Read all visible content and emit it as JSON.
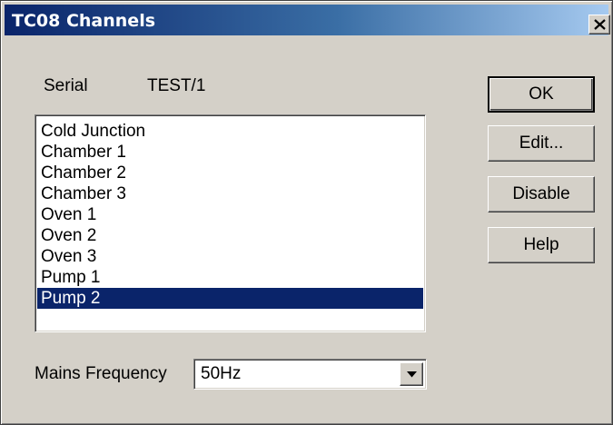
{
  "window": {
    "title": "TC08 Channels",
    "close_icon": "close-x-icon"
  },
  "serial": {
    "label": "Serial",
    "value": "TEST/1"
  },
  "channels": {
    "items": [
      "Cold Junction",
      "Chamber 1",
      "Chamber 2",
      "Chamber 3",
      "Oven 1",
      "Oven 2",
      "Oven 3",
      "Pump 1",
      "Pump 2"
    ],
    "selected": "Pump 2"
  },
  "buttons": {
    "ok": "OK",
    "edit": "Edit...",
    "disable": "Disable",
    "help": "Help"
  },
  "mains": {
    "label": "Mains Frequency",
    "value": "50Hz",
    "dropdown_icon": "dropdown-arrow-icon"
  },
  "colors": {
    "selection": "#0a246a",
    "dialog_face": "#d4d0c8"
  }
}
